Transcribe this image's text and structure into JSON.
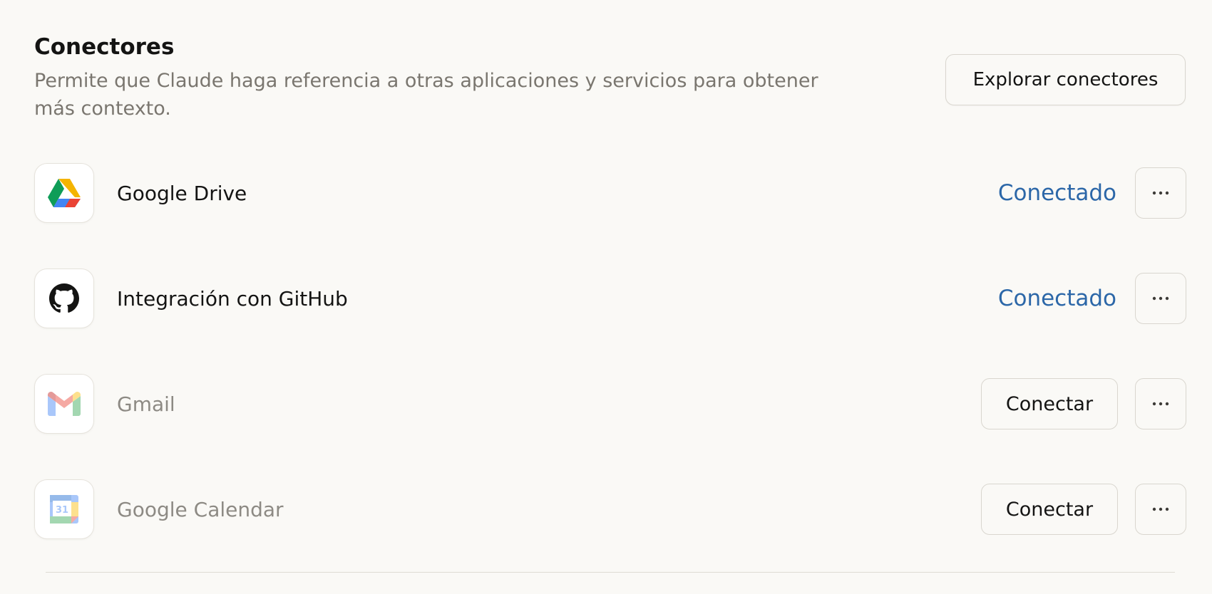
{
  "section": {
    "title": "Conectores",
    "description": "Permite que Claude haga referencia a otras aplicaciones y servicios para obtener más contexto.",
    "explore_label": "Explorar conectores"
  },
  "connectors": [
    {
      "name": "Google Drive",
      "icon": "google-drive-icon",
      "status": "Conectado",
      "connected": true
    },
    {
      "name": "Integración con GitHub",
      "icon": "github-icon",
      "status": "Conectado",
      "connected": true
    },
    {
      "name": "Gmail",
      "icon": "gmail-icon",
      "action_label": "Conectar",
      "connected": false
    },
    {
      "name": "Google Calendar",
      "icon": "google-calendar-icon",
      "calendar_day": "31",
      "action_label": "Conectar",
      "connected": false
    }
  ],
  "colors": {
    "background": "#faf9f6",
    "connected_text": "#2c67a8",
    "muted_text": "#7a766f",
    "border": "#d9d6cf"
  }
}
